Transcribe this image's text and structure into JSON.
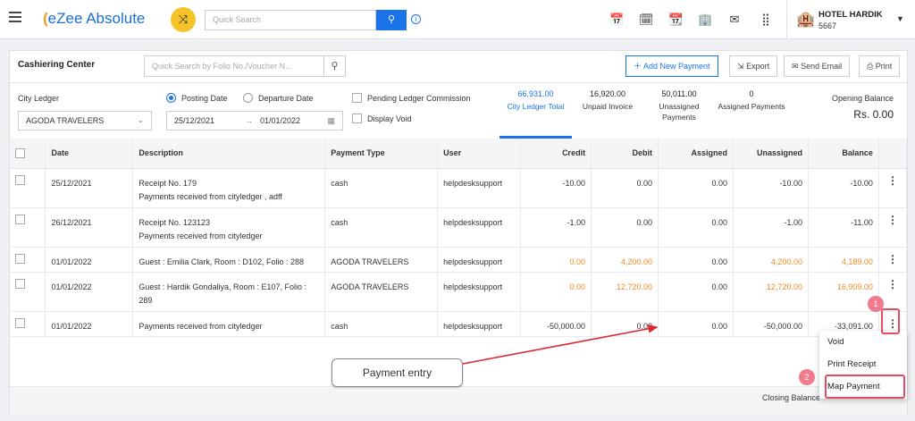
{
  "app": {
    "logo_prefix": "e",
    "logo_text": "Zee Absolute",
    "search_placeholder": "Quick Search"
  },
  "hotel": {
    "name": "HOTEL HARDIK",
    "id": "5667"
  },
  "page": {
    "title": "Cashiering Center",
    "search_placeholder": "Quick Search by Folio No./Voucher N...",
    "add_payment": "Add New Payment",
    "export": "Export",
    "send_email": "Send Email",
    "print": "Print"
  },
  "filters": {
    "city_ledger_label": "City Ledger",
    "city_ledger_value": "AGODA TRAVELERS",
    "posting_date": "Posting Date",
    "departure_date": "Departure Date",
    "date_from": "25/12/2021",
    "date_to": "01/01/2022",
    "pending_commission": "Pending Ledger Commission",
    "display_void": "Display Void"
  },
  "stats": [
    {
      "value": "66,931.00",
      "label": "City Ledger Total"
    },
    {
      "value": "16,920.00",
      "label": "Unpaid Invoice"
    },
    {
      "value": "50,011.00",
      "label": "Unassigned Payments"
    },
    {
      "value": "0",
      "label": "Assigned Payments"
    }
  ],
  "opening": {
    "label": "Opening Balance",
    "value": "Rs. 0.00"
  },
  "table": {
    "columns": [
      "Date",
      "Description",
      "Payment Type",
      "User",
      "Credit",
      "Debit",
      "Assigned",
      "Unassigned",
      "Balance"
    ],
    "rows": [
      {
        "date": "25/12/2021",
        "desc1": "Receipt No. 179",
        "desc2": "Payments received from cityledger , adff",
        "ptype": "cash",
        "user": "helpdesksupport",
        "credit": "-10.00",
        "debit": "0.00",
        "assigned": "0.00",
        "unassigned": "-10.00",
        "balance": "-10.00"
      },
      {
        "date": "26/12/2021",
        "desc1": "Receipt No. 123123",
        "desc2": "Payments received from cityledger",
        "ptype": "cash",
        "user": "helpdesksupport",
        "credit": "-1.00",
        "debit": "0.00",
        "assigned": "0.00",
        "unassigned": "-1.00",
        "balance": "-11.00"
      },
      {
        "date": "01/01/2022",
        "desc1": "Guest : Emilia Clark, Room : D102, Folio : 288",
        "desc2": "",
        "ptype": "AGODA TRAVELERS",
        "user": "helpdesksupport",
        "credit": "0.00",
        "debit": "4,200.00",
        "assigned": "0.00",
        "unassigned": "4,200.00",
        "balance": "4,189.00"
      },
      {
        "date": "01/01/2022",
        "desc1": "Guest : Hardik Gondaliya, Room : E107, Folio :",
        "desc2": "289",
        "ptype": "AGODA TRAVELERS",
        "user": "helpdesksupport",
        "credit": "0.00",
        "debit": "12,720.00",
        "assigned": "0.00",
        "unassigned": "12,720.00",
        "balance": "16,909.00"
      },
      {
        "date": "01/01/2022",
        "desc1": "Payments received from cityledger",
        "desc2": "",
        "ptype": "cash",
        "user": "helpdesksupport",
        "credit": "-50,000.00",
        "debit": "0.00",
        "assigned": "0.00",
        "unassigned": "-50,000.00",
        "balance": "-33,091.00"
      }
    ]
  },
  "footer": {
    "closing_label": "Closing Balance"
  },
  "menu": {
    "void": "Void",
    "print_receipt": "Print Receipt",
    "map_payment": "Map Payment"
  },
  "annotations": {
    "badge1": "1",
    "badge2": "2",
    "callout": "Payment entry"
  }
}
